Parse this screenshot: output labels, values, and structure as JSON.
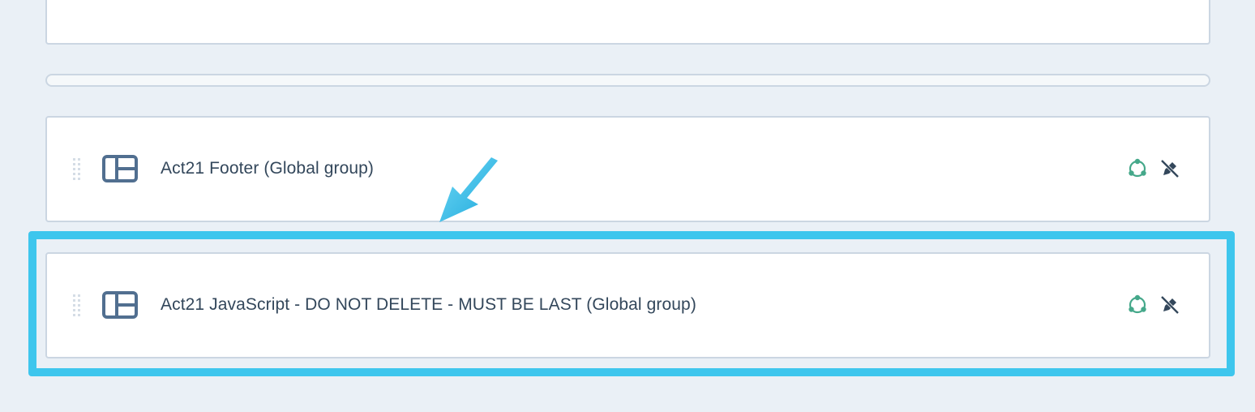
{
  "modules": [
    {
      "title": "Act21 Footer (Global group)",
      "group_icon": "layout-icon",
      "actions": [
        "global-group-icon",
        "edit-off-icon"
      ]
    },
    {
      "title": "Act21 JavaScript - DO NOT DELETE - MUST BE LAST (Global group)",
      "group_icon": "layout-icon",
      "actions": [
        "global-group-icon",
        "edit-off-icon"
      ],
      "highlighted": true
    }
  ],
  "colors": {
    "background": "#eaf0f6",
    "card_border": "#cbd6e2",
    "text": "#33475b",
    "icon": "#516f90",
    "global_icon": "#00a4bd",
    "global_icon_green": "#45a88a",
    "highlight": "#3ec6ed"
  }
}
